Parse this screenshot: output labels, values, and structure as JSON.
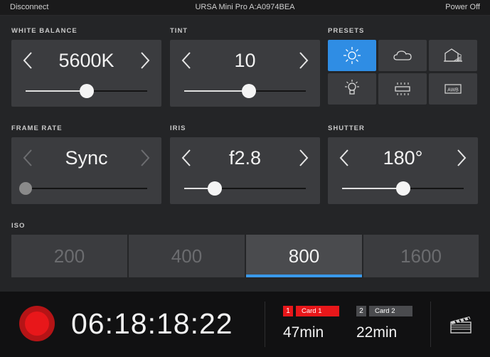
{
  "topbar": {
    "disconnect": "Disconnect",
    "camera_name": "URSA Mini Pro A:A0974BEA",
    "power_off": "Power Off"
  },
  "white_balance": {
    "label": "WHITE BALANCE",
    "value": "5600K",
    "slider_fraction": 0.5
  },
  "tint": {
    "label": "TINT",
    "value": "10",
    "slider_fraction": 0.53
  },
  "presets": {
    "label": "PRESETS",
    "items": [
      "sun-icon",
      "cloud-icon",
      "shade-icon",
      "tungsten-bulb-icon",
      "fluorescent-icon",
      "awb-icon"
    ],
    "awb_text": "AWB",
    "selected": "sun-icon"
  },
  "frame_rate": {
    "label": "FRAME RATE",
    "value": "Sync",
    "slider_fraction": 0.0
  },
  "iris": {
    "label": "IRIS",
    "value": "f2.8",
    "slider_fraction": 0.25
  },
  "shutter": {
    "label": "SHUTTER",
    "value": "180°",
    "slider_fraction": 0.5
  },
  "iso": {
    "label": "ISO",
    "options": [
      "200",
      "400",
      "800",
      "1600"
    ],
    "selected": "800"
  },
  "record": {
    "timecode": "06:18:18:22",
    "card1": {
      "number": "1",
      "name": "Card 1",
      "remaining": "47min"
    },
    "card2": {
      "number": "2",
      "name": "Card 2",
      "remaining": "22min"
    }
  },
  "colors": {
    "accent": "#2f8de4",
    "record_red": "#e8171a",
    "panel": "#3b3c3f",
    "background": "#242527"
  }
}
